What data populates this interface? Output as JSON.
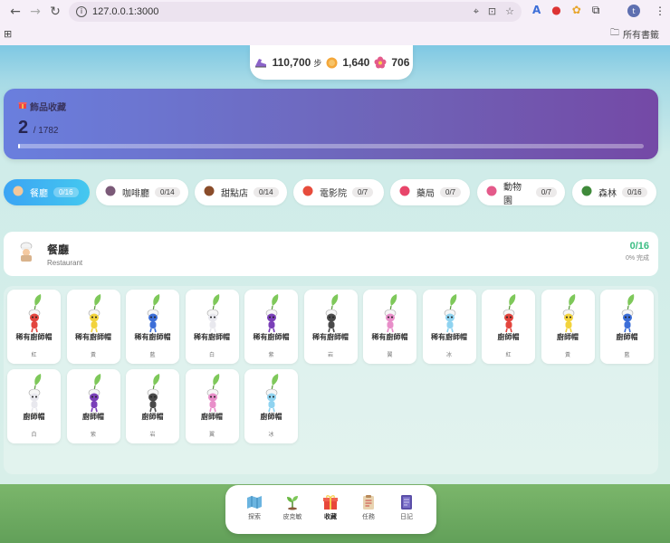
{
  "browser": {
    "url": "127.0.0.1:3000",
    "bookmarks_label": "所有書籤"
  },
  "stats": {
    "steps": "110,700",
    "steps_unit": "步",
    "coins": "1,640",
    "flowers": "706"
  },
  "collection": {
    "label": "飾品收藏",
    "count": "2",
    "total": "/ 1782",
    "progress_fraction": 0.0011
  },
  "tabs": [
    {
      "label": "餐廳",
      "count": "0/16",
      "active": true
    },
    {
      "label": "咖啡廳",
      "count": "0/14",
      "active": false
    },
    {
      "label": "甜點店",
      "count": "0/14",
      "active": false
    },
    {
      "label": "電影院",
      "count": "0/7",
      "active": false
    },
    {
      "label": "藥局",
      "count": "0/7",
      "active": false
    },
    {
      "label": "動物園",
      "count": "0/7",
      "active": false
    },
    {
      "label": "森林",
      "count": "0/16",
      "active": false
    }
  ],
  "section": {
    "title": "餐廳",
    "subtitle": "Restaurant",
    "progress": "0/16",
    "progress_label": "0% 完成"
  },
  "items": [
    {
      "name": "稀有廚師帽",
      "color_label": "紅",
      "color": "#e3453e"
    },
    {
      "name": "稀有廚師帽",
      "color_label": "黃",
      "color": "#f2d33c"
    },
    {
      "name": "稀有廚師帽",
      "color_label": "藍",
      "color": "#3c6ed8"
    },
    {
      "name": "稀有廚師帽",
      "color_label": "白",
      "color": "#e8e8ee"
    },
    {
      "name": "稀有廚師帽",
      "color_label": "紫",
      "color": "#7a3fb8"
    },
    {
      "name": "稀有廚師帽",
      "color_label": "岩",
      "color": "#4a4a4a"
    },
    {
      "name": "稀有廚師帽",
      "color_label": "翼",
      "color": "#e88ec9"
    },
    {
      "name": "稀有廚師帽",
      "color_label": "冰",
      "color": "#8fd3f0"
    },
    {
      "name": "廚師帽",
      "color_label": "紅",
      "color": "#e3453e"
    },
    {
      "name": "廚師帽",
      "color_label": "黃",
      "color": "#f2d33c"
    },
    {
      "name": "廚師帽",
      "color_label": "藍",
      "color": "#3c6ed8"
    },
    {
      "name": "廚師帽",
      "color_label": "白",
      "color": "#e8e8ee"
    },
    {
      "name": "廚師帽",
      "color_label": "紫",
      "color": "#7a3fb8"
    },
    {
      "name": "廚師帽",
      "color_label": "岩",
      "color": "#4a4a4a"
    },
    {
      "name": "廚師帽",
      "color_label": "翼",
      "color": "#e88ec9"
    },
    {
      "name": "廚師帽",
      "color_label": "冰",
      "color": "#8fd3f0"
    }
  ],
  "bottom_nav": [
    {
      "label": "探索",
      "icon": "map-icon",
      "active": false
    },
    {
      "label": "皮克敏",
      "icon": "sprout-icon",
      "active": false
    },
    {
      "label": "收藏",
      "icon": "gift-icon",
      "active": true
    },
    {
      "label": "任務",
      "icon": "clipboard-icon",
      "active": false
    },
    {
      "label": "日記",
      "icon": "diary-icon",
      "active": false
    }
  ]
}
